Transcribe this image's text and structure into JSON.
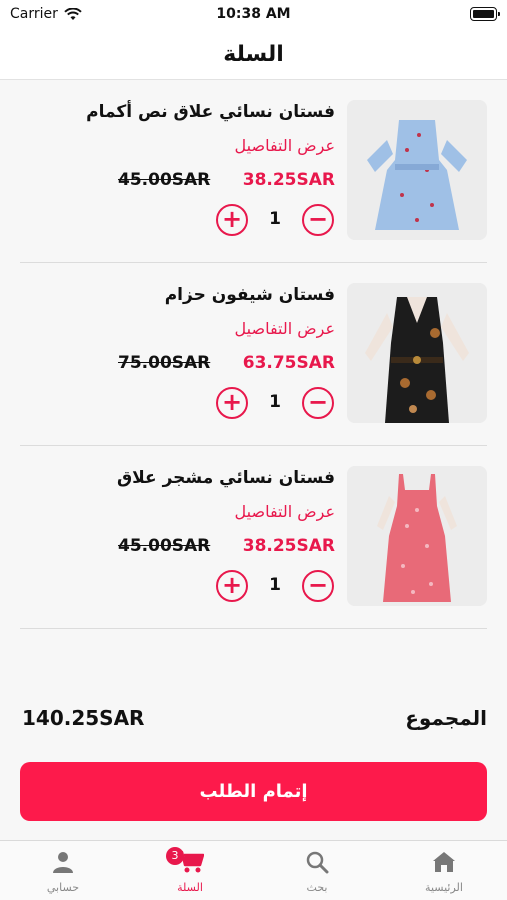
{
  "status_bar": {
    "carrier": "Carrier",
    "time": "10:38 AM"
  },
  "nav": {
    "title": "السلة"
  },
  "cart": {
    "items": [
      {
        "name": "فستان نسائي علاق نص أكمام",
        "details_link": "عرض التفاصيل",
        "price": "38.25SAR",
        "old_price": "45.00SAR",
        "quantity": "1",
        "image_icon": "dress-blue-floral-image"
      },
      {
        "name": "فستان شيفون حزام",
        "details_link": "عرض التفاصيل",
        "price": "63.75SAR",
        "old_price": "75.00SAR",
        "quantity": "1",
        "image_icon": "dress-black-chiffon-image"
      },
      {
        "name": "فستان نسائي مشجر علاق",
        "details_link": "عرض التفاصيل",
        "price": "38.25SAR",
        "old_price": "45.00SAR",
        "quantity": "1",
        "image_icon": "dress-pink-floral-image"
      }
    ]
  },
  "summary": {
    "total_label": "المجموع",
    "total_value": "140.25SAR"
  },
  "checkout": {
    "label": "إتمام الطلب"
  },
  "tab_bar": {
    "tabs": [
      {
        "label": "الرئيسية",
        "icon": "home-icon"
      },
      {
        "label": "بحث",
        "icon": "search-icon"
      },
      {
        "label": "السلة",
        "icon": "cart-icon",
        "badge": "3",
        "active": true
      },
      {
        "label": "حسابي",
        "icon": "person-icon"
      }
    ]
  },
  "colors": {
    "accent": "#fd1a4b",
    "text": "#111111",
    "background": "#f7f7f7"
  }
}
